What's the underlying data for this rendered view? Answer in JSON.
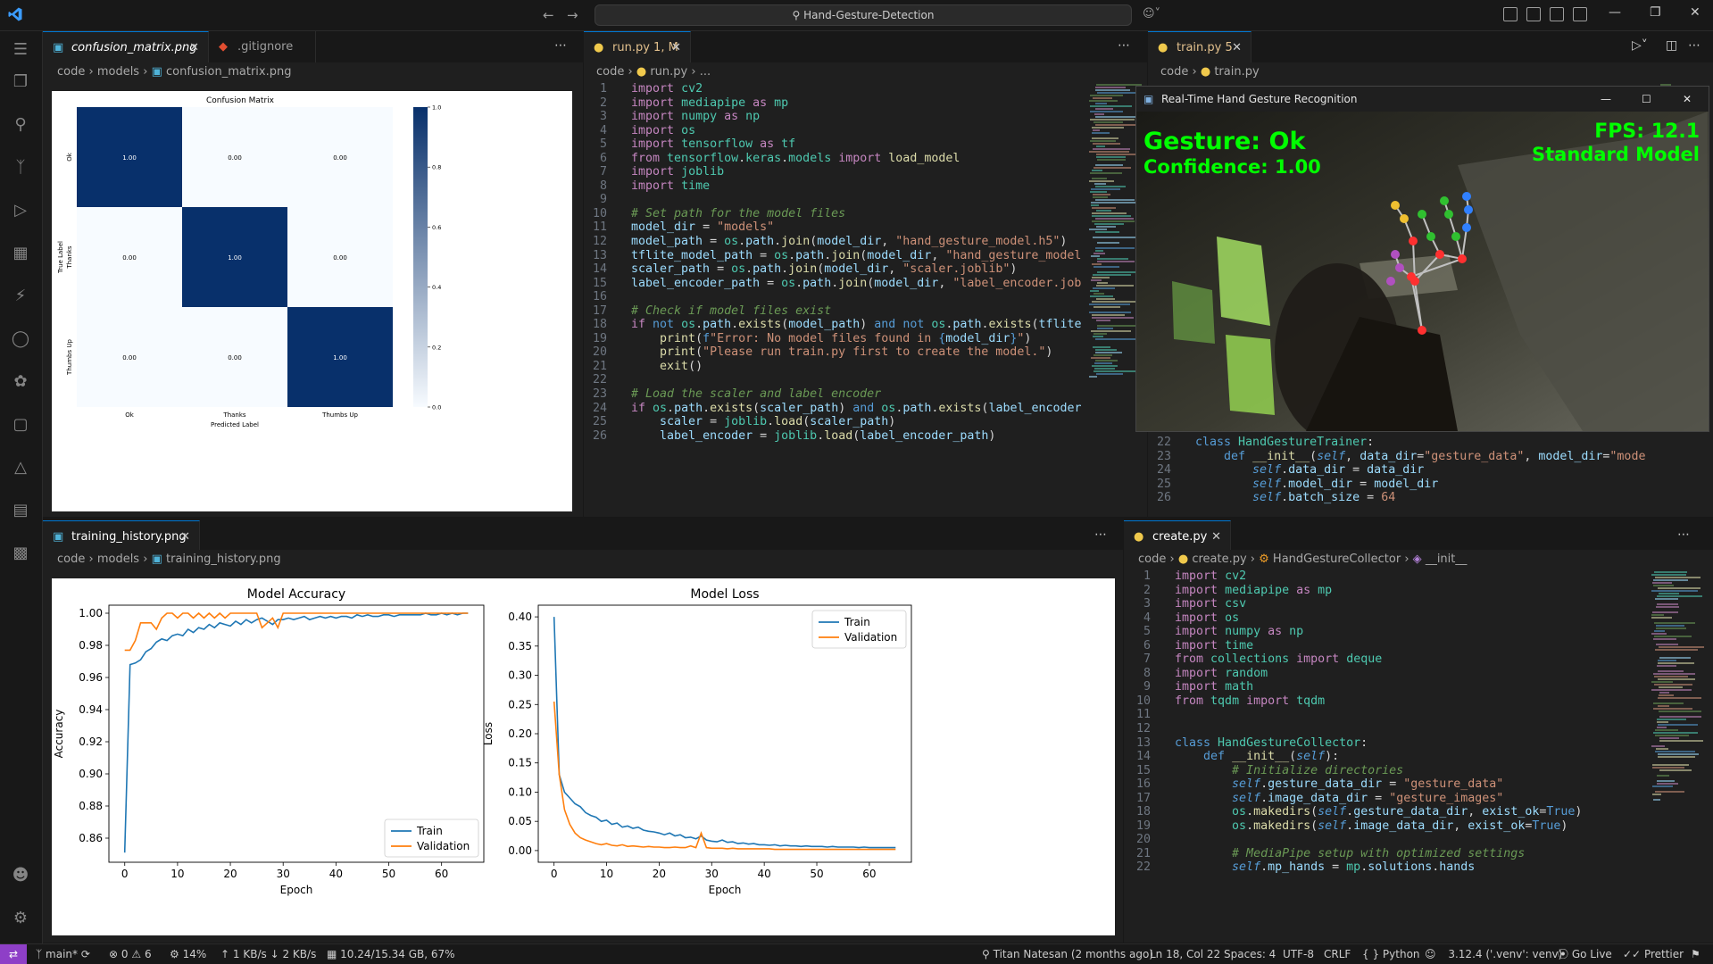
{
  "titlebar": {
    "search": "Hand-Gesture-Detection"
  },
  "left_group": {
    "tabs": [
      {
        "label": "confusion_matrix.png",
        "icon": "image-icon",
        "active": true
      },
      {
        "label": ".gitignore",
        "icon": "git-icon",
        "active": false
      }
    ],
    "breadcrumb": [
      "code",
      "models",
      "confusion_matrix.png"
    ]
  },
  "confusion_matrix": {
    "title": "Confusion Matrix",
    "xlabel": "Predicted Label",
    "ylabel": "True Label",
    "labels": [
      "Ok",
      "Thanks",
      "Thumbs Up"
    ],
    "cells": [
      [
        "1.00",
        "0.00",
        "0.00"
      ],
      [
        "0.00",
        "1.00",
        "0.00"
      ],
      [
        "0.00",
        "0.00",
        "1.00"
      ]
    ],
    "colorbar_ticks": [
      "1.0",
      "0.8",
      "0.6",
      "0.4",
      "0.2",
      "0.0"
    ]
  },
  "run_group": {
    "tab": {
      "label": "run.py",
      "badge": "1, M"
    },
    "breadcrumb": [
      "code",
      "run.py",
      "..."
    ],
    "lines": [
      {
        "n": "1",
        "html": "<span class='k'>import</span> <span class='t'>cv2</span>"
      },
      {
        "n": "2",
        "html": "<span class='k'>import</span> <span class='t'>mediapipe</span> <span class='k'>as</span> <span class='t'>mp</span>"
      },
      {
        "n": "3",
        "html": "<span class='k'>import</span> <span class='t'>numpy</span> <span class='k'>as</span> <span class='t'>np</span>"
      },
      {
        "n": "4",
        "html": "<span class='k'>import</span> <span class='t'>os</span>"
      },
      {
        "n": "5",
        "html": "<span class='k'>import</span> <span class='t'>tensorflow</span> <span class='k'>as</span> <span class='t'>tf</span>"
      },
      {
        "n": "6",
        "html": "<span class='k'>from</span> <span class='t'>tensorflow</span>.<span class='t'>keras</span>.<span class='t'>models</span> <span class='k'>import</span> <span class='f'>load_model</span>"
      },
      {
        "n": "7",
        "html": "<span class='k'>import</span> <span class='t'>joblib</span>"
      },
      {
        "n": "8",
        "html": "<span class='k'>import</span> <span class='t'>time</span>"
      },
      {
        "n": "9",
        "html": ""
      },
      {
        "n": "10",
        "html": "<span class='c'># Set path for the model files</span>"
      },
      {
        "n": "11",
        "html": "<span class='v'>model_dir</span> = <span class='s'>\"models\"</span>"
      },
      {
        "n": "12",
        "html": "<span class='v'>model_path</span> = <span class='t'>os</span>.<span class='v'>path</span>.<span class='f'>join</span>(<span class='v'>model_dir</span>, <span class='s'>\"hand_gesture_model.h5\"</span>)"
      },
      {
        "n": "13",
        "html": "<span class='v'>tflite_model_path</span> = <span class='t'>os</span>.<span class='v'>path</span>.<span class='f'>join</span>(<span class='v'>model_dir</span>, <span class='s'>\"hand_gesture_model</span>"
      },
      {
        "n": "14",
        "html": "<span class='v'>scaler_path</span> = <span class='t'>os</span>.<span class='v'>path</span>.<span class='f'>join</span>(<span class='v'>model_dir</span>, <span class='s'>\"scaler.joblib\"</span>)"
      },
      {
        "n": "15",
        "html": "<span class='v'>label_encoder_path</span> = <span class='t'>os</span>.<span class='v'>path</span>.<span class='f'>join</span>(<span class='v'>model_dir</span>, <span class='s'>\"label_encoder.job</span>"
      },
      {
        "n": "16",
        "html": ""
      },
      {
        "n": "17",
        "html": "<span class='c'># Check if model files exist</span>"
      },
      {
        "n": "18",
        "html": "<span class='k'>if</span> <span class='b'>not</span> <span class='t'>os</span>.<span class='v'>path</span>.<span class='f'>exists</span>(<span class='v'>model_path</span>) <span class='b'>and</span> <span class='b'>not</span> <span class='t'>os</span>.<span class='v'>path</span>.<span class='f'>exists</span>(<span class='v'>tflite</span>"
      },
      {
        "n": "19",
        "html": "    <span class='f'>print</span>(<span class='b'>f</span><span class='s'>\"Error: No model files found in </span><span class='b'>{</span><span class='v'>model_dir</span><span class='b'>}</span><span class='s'>\"</span>)"
      },
      {
        "n": "20",
        "html": "    <span class='f'>print</span>(<span class='s'>\"Please run train.py first to create the model.\"</span>)"
      },
      {
        "n": "21",
        "html": "    <span class='f'>exit</span>()"
      },
      {
        "n": "22",
        "html": ""
      },
      {
        "n": "23",
        "html": "<span class='c'># Load the scaler and label encoder</span>"
      },
      {
        "n": "24",
        "html": "<span class='k'>if</span> <span class='t'>os</span>.<span class='v'>path</span>.<span class='f'>exists</span>(<span class='v'>scaler_path</span>) <span class='b'>and</span> <span class='t'>os</span>.<span class='v'>path</span>.<span class='f'>exists</span>(<span class='v'>label_encoder</span>"
      },
      {
        "n": "25",
        "html": "    <span class='v'>scaler</span> = <span class='t'>joblib</span>.<span class='f'>load</span>(<span class='v'>scaler_path</span>)"
      },
      {
        "n": "26",
        "html": "    <span class='v'>label_encoder</span> = <span class='t'>joblib</span>.<span class='f'>load</span>(<span class='v'>label_encoder_path</span>)"
      }
    ]
  },
  "train_group": {
    "tab": {
      "label": "train.py",
      "badge": "5"
    },
    "breadcrumb": [
      "code",
      "train.py"
    ],
    "lines": [
      {
        "n": "22",
        "html": "<span class='b'>class</span> <span class='t'>HandGestureTrainer</span>:"
      },
      {
        "n": "23",
        "html": "    <span class='b'>def</span> <span class='f'>__init__</span>(<span class='sf'>self</span>, <span class='v'>data_dir</span>=<span class='s'>\"gesture_data\"</span>, <span class='v'>model_dir</span>=<span class='s'>\"mode</span>"
      },
      {
        "n": "24",
        "html": "        <span class='sf'>self</span>.<span class='v'>data_dir</span> = <span class='v'>data_dir</span>"
      },
      {
        "n": "25",
        "html": "        <span class='sf'>self</span>.<span class='v'>model_dir</span> = <span class='v'>model_dir</span>"
      },
      {
        "n": "26",
        "html": "        <span class='sf'>self</span>.<span class='v'>batch_size</span> = <span class='s'>64</span>"
      }
    ]
  },
  "camera_window": {
    "title": "Real-Time Hand Gesture Recognition",
    "gesture": "Gesture: Ok",
    "confidence": "Confidence: 1.00",
    "fps": "FPS: 12.1",
    "model": "Standard Model"
  },
  "history_group": {
    "tab": {
      "label": "training_history.png"
    },
    "breadcrumb": [
      "code",
      "models",
      "training_history.png"
    ]
  },
  "accuracy_chart": {
    "title": "Model Accuracy",
    "xlabel": "Epoch",
    "ylabel": "Accuracy",
    "xticks": [
      "0",
      "10",
      "20",
      "30",
      "40",
      "50",
      "60"
    ],
    "yticks": [
      "0.86",
      "0.88",
      "0.90",
      "0.92",
      "0.94",
      "0.96",
      "0.98",
      "1.00"
    ],
    "legend": [
      "Train",
      "Validation"
    ]
  },
  "loss_chart": {
    "title": "Model Loss",
    "xlabel": "Epoch",
    "ylabel": "Loss",
    "xticks": [
      "0",
      "10",
      "20",
      "30",
      "40",
      "50",
      "60"
    ],
    "yticks": [
      "0.00",
      "0.05",
      "0.10",
      "0.15",
      "0.20",
      "0.25",
      "0.30",
      "0.35",
      "0.40"
    ],
    "legend": [
      "Train",
      "Validation"
    ]
  },
  "chart_data": [
    {
      "type": "heatmap",
      "title": "Confusion Matrix",
      "xlabel": "Predicted Label",
      "ylabel": "True Label",
      "x": [
        "Ok",
        "Thanks",
        "Thumbs Up"
      ],
      "y": [
        "Ok",
        "Thanks",
        "Thumbs Up"
      ],
      "values": [
        [
          1.0,
          0.0,
          0.0
        ],
        [
          0.0,
          1.0,
          0.0
        ],
        [
          0.0,
          0.0,
          1.0
        ]
      ],
      "colorbar_range": [
        0.0,
        1.0
      ]
    },
    {
      "type": "line",
      "title": "Model Accuracy",
      "xlabel": "Epoch",
      "ylabel": "Accuracy",
      "ylim": [
        0.845,
        1.005
      ],
      "xlim": [
        -3,
        68
      ],
      "legend_position": "lower-right",
      "x": [
        0,
        1,
        2,
        3,
        4,
        5,
        6,
        7,
        8,
        9,
        10,
        11,
        12,
        13,
        14,
        15,
        16,
        17,
        18,
        19,
        20,
        21,
        22,
        23,
        24,
        25,
        26,
        27,
        28,
        29,
        30,
        31,
        32,
        33,
        34,
        35,
        36,
        37,
        38,
        39,
        40,
        41,
        42,
        43,
        44,
        45,
        46,
        47,
        48,
        49,
        50,
        51,
        52,
        53,
        54,
        55,
        56,
        57,
        58,
        59,
        60,
        61,
        62,
        63,
        64,
        65
      ],
      "series": [
        {
          "name": "Train",
          "color": "#1f77b4",
          "values": [
            0.851,
            0.968,
            0.969,
            0.971,
            0.976,
            0.978,
            0.982,
            0.984,
            0.983,
            0.986,
            0.987,
            0.986,
            0.99,
            0.988,
            0.991,
            0.99,
            0.993,
            0.991,
            0.994,
            0.993,
            0.992,
            0.995,
            0.993,
            0.996,
            0.994,
            0.996,
            0.997,
            0.995,
            0.993,
            0.996,
            0.996,
            0.997,
            0.996,
            0.997,
            0.998,
            0.996,
            0.997,
            0.998,
            0.997,
            0.998,
            0.997,
            0.998,
            0.998,
            0.997,
            0.999,
            0.998,
            0.999,
            0.998,
            0.998,
            0.999,
            0.999,
            0.998,
            0.999,
            0.999,
            0.999,
            0.999,
            0.999,
            1.0,
            0.999,
            0.999,
            1.0,
            0.999,
            1.0,
            0.999,
            1.0,
            1.0
          ]
        },
        {
          "name": "Validation",
          "color": "#ff7f0e",
          "values": [
            0.977,
            0.977,
            0.983,
            0.994,
            0.994,
            0.994,
            0.99,
            0.997,
            1.0,
            1.0,
            0.997,
            1.0,
            1.0,
            0.997,
            1.0,
            0.997,
            1.0,
            0.997,
            1.0,
            0.997,
            1.0,
            1.0,
            1.0,
            1.0,
            1.0,
            1.0,
            0.991,
            0.994,
            0.997,
            0.991,
            1.0,
            1.0,
            1.0,
            1.0,
            1.0,
            1.0,
            1.0,
            1.0,
            1.0,
            1.0,
            1.0,
            1.0,
            1.0,
            1.0,
            1.0,
            1.0,
            1.0,
            1.0,
            1.0,
            1.0,
            1.0,
            1.0,
            1.0,
            1.0,
            1.0,
            1.0,
            1.0,
            1.0,
            1.0,
            1.0,
            1.0,
            1.0,
            1.0,
            1.0,
            1.0,
            1.0
          ]
        }
      ]
    },
    {
      "type": "line",
      "title": "Model Loss",
      "xlabel": "Epoch",
      "ylabel": "Loss",
      "ylim": [
        -0.02,
        0.42
      ],
      "xlim": [
        -3,
        68
      ],
      "legend_position": "upper-right",
      "x": [
        0,
        1,
        2,
        3,
        4,
        5,
        6,
        7,
        8,
        9,
        10,
        11,
        12,
        13,
        14,
        15,
        16,
        17,
        18,
        19,
        20,
        21,
        22,
        23,
        24,
        25,
        26,
        27,
        28,
        29,
        30,
        31,
        32,
        33,
        34,
        35,
        36,
        37,
        38,
        39,
        40,
        41,
        42,
        43,
        44,
        45,
        46,
        47,
        48,
        49,
        50,
        51,
        52,
        53,
        54,
        55,
        56,
        57,
        58,
        59,
        60,
        61,
        62,
        63,
        64,
        65
      ],
      "series": [
        {
          "name": "Train",
          "color": "#1f77b4",
          "values": [
            0.4,
            0.13,
            0.1,
            0.09,
            0.08,
            0.075,
            0.065,
            0.06,
            0.057,
            0.05,
            0.052,
            0.045,
            0.047,
            0.04,
            0.042,
            0.038,
            0.04,
            0.035,
            0.033,
            0.032,
            0.03,
            0.027,
            0.03,
            0.025,
            0.027,
            0.022,
            0.023,
            0.02,
            0.025,
            0.018,
            0.016,
            0.015,
            0.018,
            0.014,
            0.015,
            0.012,
            0.013,
            0.011,
            0.012,
            0.01,
            0.01,
            0.009,
            0.01,
            0.008,
            0.009,
            0.008,
            0.008,
            0.007,
            0.008,
            0.007,
            0.007,
            0.007,
            0.006,
            0.007,
            0.006,
            0.006,
            0.006,
            0.006,
            0.005,
            0.006,
            0.005,
            0.005,
            0.005,
            0.005,
            0.005,
            0.005
          ]
        },
        {
          "name": "Validation",
          "color": "#ff7f0e",
          "values": [
            0.255,
            0.13,
            0.07,
            0.045,
            0.03,
            0.022,
            0.018,
            0.015,
            0.012,
            0.01,
            0.012,
            0.009,
            0.008,
            0.01,
            0.007,
            0.008,
            0.007,
            0.006,
            0.007,
            0.006,
            0.006,
            0.005,
            0.005,
            0.006,
            0.005,
            0.005,
            0.008,
            0.005,
            0.03,
            0.005,
            0.004,
            0.004,
            0.004,
            0.003,
            0.004,
            0.003,
            0.003,
            0.003,
            0.003,
            0.003,
            0.003,
            0.003,
            0.002,
            0.002,
            0.002,
            0.002,
            0.002,
            0.002,
            0.002,
            0.002,
            0.002,
            0.002,
            0.002,
            0.002,
            0.002,
            0.002,
            0.002,
            0.002,
            0.002,
            0.002,
            0.002,
            0.002,
            0.002,
            0.002,
            0.002,
            0.002
          ]
        }
      ]
    }
  ],
  "create_group": {
    "tab": {
      "label": "create.py"
    },
    "breadcrumb": [
      "code",
      "create.py",
      "HandGestureCollector",
      "__init__"
    ],
    "lines": [
      {
        "n": "1",
        "html": "<span class='k'>import</span> <span class='t'>cv2</span>"
      },
      {
        "n": "2",
        "html": "<span class='k'>import</span> <span class='t'>mediapipe</span> <span class='k'>as</span> <span class='t'>mp</span>"
      },
      {
        "n": "3",
        "html": "<span class='k'>import</span> <span class='t'>csv</span>"
      },
      {
        "n": "4",
        "html": "<span class='k'>import</span> <span class='t'>os</span>"
      },
      {
        "n": "5",
        "html": "<span class='k'>import</span> <span class='t'>numpy</span> <span class='k'>as</span> <span class='t'>np</span>"
      },
      {
        "n": "6",
        "html": "<span class='k'>import</span> <span class='t'>time</span>"
      },
      {
        "n": "7",
        "html": "<span class='k'>from</span> <span class='t'>collections</span> <span class='k'>import</span> <span class='t'>deque</span>"
      },
      {
        "n": "8",
        "html": "<span class='k'>import</span> <span class='t'>random</span>"
      },
      {
        "n": "9",
        "html": "<span class='k'>import</span> <span class='t'>math</span>"
      },
      {
        "n": "10",
        "html": "<span class='k'>from</span> <span class='t'>tqdm</span> <span class='k'>import</span> <span class='t'>tqdm</span>"
      },
      {
        "n": "11",
        "html": ""
      },
      {
        "n": "12",
        "html": ""
      },
      {
        "n": "13",
        "html": "<span class='b'>class</span> <span class='t'>HandGestureCollector</span>:"
      },
      {
        "n": "14",
        "html": "    <span class='b'>def</span> <span class='f'>__init__</span>(<span class='sf'>self</span>):"
      },
      {
        "n": "15",
        "html": "        <span class='c'># Initialize directories</span>"
      },
      {
        "n": "16",
        "html": "        <span class='sf'>self</span>.<span class='v'>gesture_data_dir</span> = <span class='s'>\"gesture_data\"</span>"
      },
      {
        "n": "17",
        "html": "        <span class='sf'>self</span>.<span class='v'>image_data_dir</span> = <span class='s'>\"gesture_images\"</span>"
      },
      {
        "n": "18",
        "html": "        <span class='t'>os</span>.<span class='f'>makedirs</span>(<span class='sf'>self</span>.<span class='v'>gesture_data_dir</span>, <span class='v'>exist_ok</span>=<span class='b'>True</span>)"
      },
      {
        "n": "19",
        "html": "        <span class='t'>os</span>.<span class='f'>makedirs</span>(<span class='sf'>self</span>.<span class='v'>image_data_dir</span>, <span class='v'>exist_ok</span>=<span class='b'>True</span>)"
      },
      {
        "n": "20",
        "html": ""
      },
      {
        "n": "21",
        "html": "        <span class='c'># MediaPipe setup with optimized settings</span>"
      },
      {
        "n": "22",
        "html": "        <span class='sf'>self</span>.<span class='v'>mp_hands</span> = <span class='t'>mp</span>.<span class='v'>solutions</span>.<span class='v'>hands</span>"
      }
    ]
  },
  "statusbar": {
    "branch": "main*",
    "errors": "0",
    "warnings": "6",
    "cpu": "14%",
    "net_up": "1 KB/s",
    "net_down": "2 KB/s",
    "memory": "10.24/15.34 GB, 67%",
    "blame": "Titan Natesan (2 months ago)",
    "position": "Ln 18, Col 22",
    "spaces": "Spaces: 4",
    "encoding": "UTF-8",
    "eol": "CRLF",
    "language": "Python",
    "interpreter": "3.12.4 ('.venv': venv)",
    "golive": "Go Live",
    "prettier": "Prettier"
  }
}
